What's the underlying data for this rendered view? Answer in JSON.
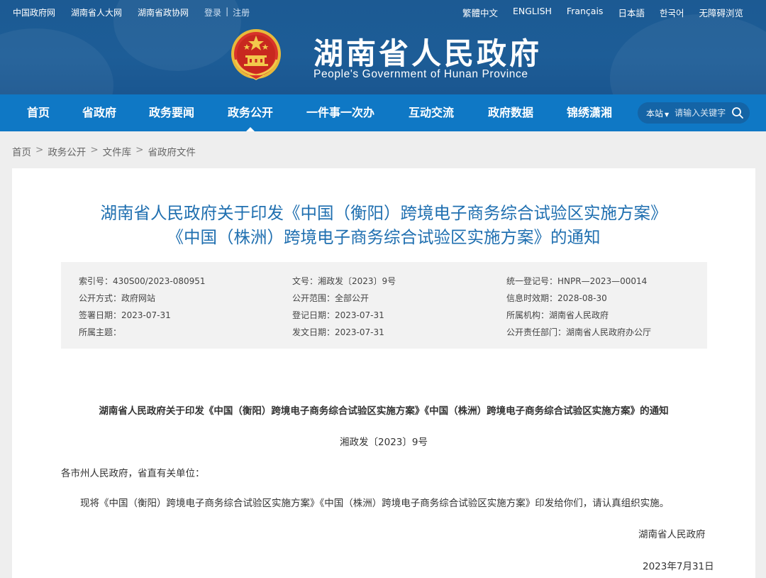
{
  "topbar": {
    "links": [
      "中国政府网",
      "湖南省人大网",
      "湖南省政协网"
    ],
    "login": "登录",
    "divider": "|",
    "register": "注册",
    "languages": [
      "繁體中文",
      "ENGLISH",
      "Français",
      "日本語",
      "한국어",
      "无障碍浏览"
    ]
  },
  "header": {
    "title": "湖南省人民政府",
    "subtitle": "People's Government of Hunan Province"
  },
  "nav": {
    "items": [
      "首页",
      "省政府",
      "政务要闻",
      "政务公开",
      "一件事一次办",
      "互动交流",
      "政府数据",
      "锦绣潇湘"
    ],
    "active": "政务公开"
  },
  "search": {
    "scope": "本站",
    "placeholder": "请输入关键字"
  },
  "breadcrumb": {
    "items": [
      "首页",
      "政务公开",
      "文件库",
      "省政府文件"
    ],
    "sep": ">"
  },
  "document": {
    "title_line1": "湖南省人民政府关于印发《中国（衡阳）跨境电子商务综合试验区实施方案》",
    "title_line2": "《中国（株洲）跨境电子商务综合试验区实施方案》的通知",
    "meta": {
      "row1": [
        "索引号：430S00/2023-080951",
        "文号：湘政发〔2023〕9号",
        "统一登记号：HNPR—2023—00014"
      ],
      "row2": [
        "公开方式：政府网站",
        "公开范围：全部公开",
        "信息时效期：2028-08-30"
      ],
      "row3": [
        "签署日期：2023-07-31",
        "登记日期：2023-07-31",
        "所属机构：湖南省人民政府"
      ],
      "row4": [
        "所属主题：",
        "发文日期：2023-07-31",
        "公开责任部门：湖南省人民政府办公厅"
      ]
    },
    "body_title": "湖南省人民政府关于印发《中国（衡阳）跨境电子商务综合试验区实施方案》《中国（株洲）跨境电子商务综合试验区实施方案》的通知",
    "doc_number": "湘政发〔2023〕9号",
    "salutation": "各市州人民政府，省直有关单位：",
    "paragraph": "现将《中国（衡阳）跨境电子商务综合试验区实施方案》《中国（株洲）跨境电子商务综合试验区实施方案》印发给你们，请认真组织实施。",
    "signature": "湖南省人民政府",
    "date": "2023年7月31日"
  },
  "colors": {
    "banner": "#1c5a93",
    "nav": "#0f78c5",
    "title_blue": "#1f6fb0",
    "meta_bg": "#f2f2f2",
    "page_bg": "#eeeeee"
  }
}
